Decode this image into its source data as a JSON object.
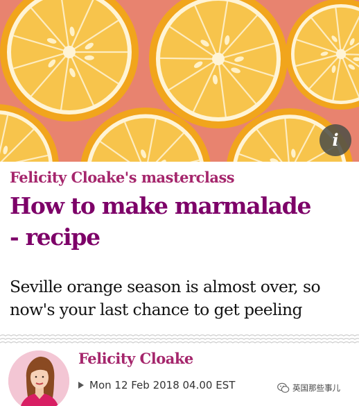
{
  "hero": {
    "image": "sliced-oranges-photo",
    "info_button_glyph": "i",
    "colors": {
      "background": "#e8836f",
      "peel": "#f1a51c",
      "flesh": "#f7c44c",
      "pith": "#fff4d6"
    }
  },
  "article": {
    "kicker": "Felicity Cloake's masterclass",
    "headline_line1": "How to make marmalade",
    "headline_line2": "- recipe",
    "standfirst_line1": "Seville orange season is almost over, so",
    "standfirst_line2": "now's your last chance to get peeling",
    "accent_color": "#a5266c",
    "headline_color": "#7d0068"
  },
  "byline": {
    "author": "Felicity Cloake",
    "date": "Mon 12 Feb 2018 04.00 EST"
  },
  "watermark": {
    "text": "英国那些事儿",
    "icon": "wechat-icon"
  }
}
